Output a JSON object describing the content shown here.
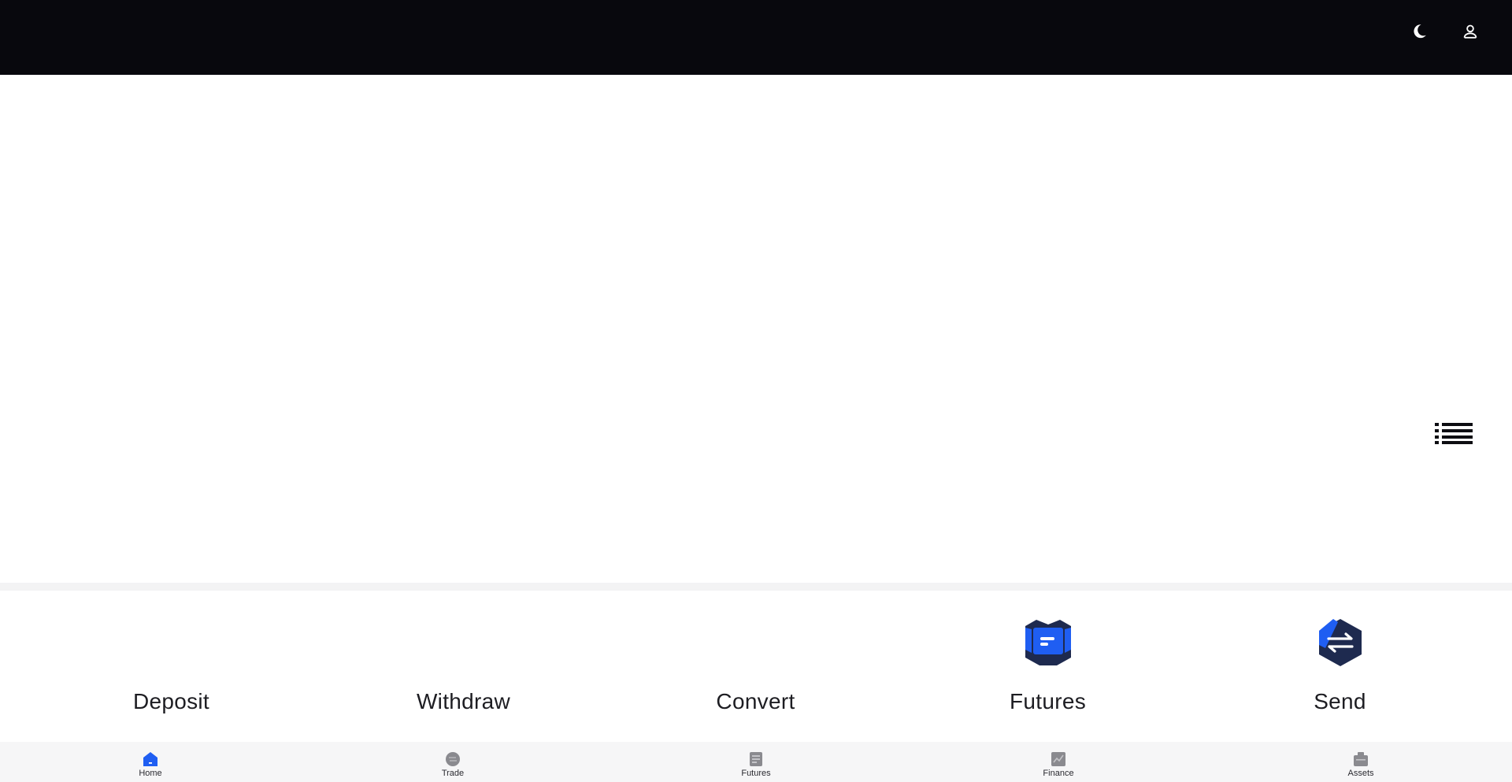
{
  "colors": {
    "topbar_bg": "#08080d",
    "accent_blue": "#1f5ef2",
    "icon_navy": "#1e2a4f",
    "nav_bg": "#f6f6f7",
    "icon_gray": "#8a8a8f"
  },
  "topbar": {
    "theme_icon": "moon-icon",
    "user_icon": "user-icon"
  },
  "banner": {
    "menu_icon": "list-icon"
  },
  "actions": [
    {
      "label": "Deposit",
      "icon": "deposit-icon"
    },
    {
      "label": "Withdraw",
      "icon": "withdraw-icon"
    },
    {
      "label": "Convert",
      "icon": "convert-icon"
    },
    {
      "label": "Futures",
      "icon": "futures-icon"
    },
    {
      "label": "Send",
      "icon": "send-icon"
    }
  ],
  "bottom_nav": {
    "active": "Home",
    "items": [
      {
        "label": "Home",
        "icon": "home-icon"
      },
      {
        "label": "Trade",
        "icon": "trade-icon"
      },
      {
        "label": "Futures",
        "icon": "futures-icon"
      },
      {
        "label": "Finance",
        "icon": "finance-icon"
      },
      {
        "label": "Assets",
        "icon": "assets-icon"
      }
    ]
  }
}
